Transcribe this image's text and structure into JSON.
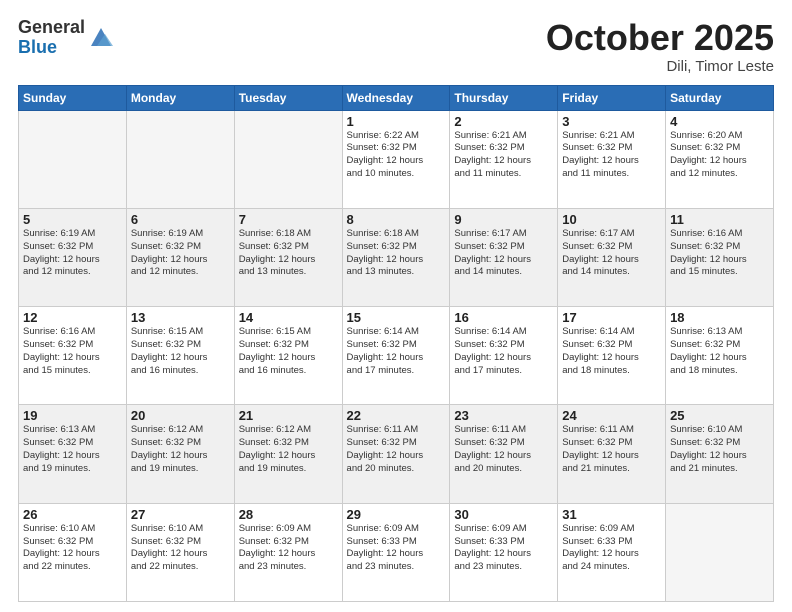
{
  "header": {
    "logo_general": "General",
    "logo_blue": "Blue",
    "month_year": "October 2025",
    "location": "Dili, Timor Leste"
  },
  "days_of_week": [
    "Sunday",
    "Monday",
    "Tuesday",
    "Wednesday",
    "Thursday",
    "Friday",
    "Saturday"
  ],
  "weeks": [
    [
      {
        "day": "",
        "info": ""
      },
      {
        "day": "",
        "info": ""
      },
      {
        "day": "",
        "info": ""
      },
      {
        "day": "1",
        "info": "Sunrise: 6:22 AM\nSunset: 6:32 PM\nDaylight: 12 hours\nand 10 minutes."
      },
      {
        "day": "2",
        "info": "Sunrise: 6:21 AM\nSunset: 6:32 PM\nDaylight: 12 hours\nand 11 minutes."
      },
      {
        "day": "3",
        "info": "Sunrise: 6:21 AM\nSunset: 6:32 PM\nDaylight: 12 hours\nand 11 minutes."
      },
      {
        "day": "4",
        "info": "Sunrise: 6:20 AM\nSunset: 6:32 PM\nDaylight: 12 hours\nand 12 minutes."
      }
    ],
    [
      {
        "day": "5",
        "info": "Sunrise: 6:19 AM\nSunset: 6:32 PM\nDaylight: 12 hours\nand 12 minutes."
      },
      {
        "day": "6",
        "info": "Sunrise: 6:19 AM\nSunset: 6:32 PM\nDaylight: 12 hours\nand 12 minutes."
      },
      {
        "day": "7",
        "info": "Sunrise: 6:18 AM\nSunset: 6:32 PM\nDaylight: 12 hours\nand 13 minutes."
      },
      {
        "day": "8",
        "info": "Sunrise: 6:18 AM\nSunset: 6:32 PM\nDaylight: 12 hours\nand 13 minutes."
      },
      {
        "day": "9",
        "info": "Sunrise: 6:17 AM\nSunset: 6:32 PM\nDaylight: 12 hours\nand 14 minutes."
      },
      {
        "day": "10",
        "info": "Sunrise: 6:17 AM\nSunset: 6:32 PM\nDaylight: 12 hours\nand 14 minutes."
      },
      {
        "day": "11",
        "info": "Sunrise: 6:16 AM\nSunset: 6:32 PM\nDaylight: 12 hours\nand 15 minutes."
      }
    ],
    [
      {
        "day": "12",
        "info": "Sunrise: 6:16 AM\nSunset: 6:32 PM\nDaylight: 12 hours\nand 15 minutes."
      },
      {
        "day": "13",
        "info": "Sunrise: 6:15 AM\nSunset: 6:32 PM\nDaylight: 12 hours\nand 16 minutes."
      },
      {
        "day": "14",
        "info": "Sunrise: 6:15 AM\nSunset: 6:32 PM\nDaylight: 12 hours\nand 16 minutes."
      },
      {
        "day": "15",
        "info": "Sunrise: 6:14 AM\nSunset: 6:32 PM\nDaylight: 12 hours\nand 17 minutes."
      },
      {
        "day": "16",
        "info": "Sunrise: 6:14 AM\nSunset: 6:32 PM\nDaylight: 12 hours\nand 17 minutes."
      },
      {
        "day": "17",
        "info": "Sunrise: 6:14 AM\nSunset: 6:32 PM\nDaylight: 12 hours\nand 18 minutes."
      },
      {
        "day": "18",
        "info": "Sunrise: 6:13 AM\nSunset: 6:32 PM\nDaylight: 12 hours\nand 18 minutes."
      }
    ],
    [
      {
        "day": "19",
        "info": "Sunrise: 6:13 AM\nSunset: 6:32 PM\nDaylight: 12 hours\nand 19 minutes."
      },
      {
        "day": "20",
        "info": "Sunrise: 6:12 AM\nSunset: 6:32 PM\nDaylight: 12 hours\nand 19 minutes."
      },
      {
        "day": "21",
        "info": "Sunrise: 6:12 AM\nSunset: 6:32 PM\nDaylight: 12 hours\nand 19 minutes."
      },
      {
        "day": "22",
        "info": "Sunrise: 6:11 AM\nSunset: 6:32 PM\nDaylight: 12 hours\nand 20 minutes."
      },
      {
        "day": "23",
        "info": "Sunrise: 6:11 AM\nSunset: 6:32 PM\nDaylight: 12 hours\nand 20 minutes."
      },
      {
        "day": "24",
        "info": "Sunrise: 6:11 AM\nSunset: 6:32 PM\nDaylight: 12 hours\nand 21 minutes."
      },
      {
        "day": "25",
        "info": "Sunrise: 6:10 AM\nSunset: 6:32 PM\nDaylight: 12 hours\nand 21 minutes."
      }
    ],
    [
      {
        "day": "26",
        "info": "Sunrise: 6:10 AM\nSunset: 6:32 PM\nDaylight: 12 hours\nand 22 minutes."
      },
      {
        "day": "27",
        "info": "Sunrise: 6:10 AM\nSunset: 6:32 PM\nDaylight: 12 hours\nand 22 minutes."
      },
      {
        "day": "28",
        "info": "Sunrise: 6:09 AM\nSunset: 6:32 PM\nDaylight: 12 hours\nand 23 minutes."
      },
      {
        "day": "29",
        "info": "Sunrise: 6:09 AM\nSunset: 6:33 PM\nDaylight: 12 hours\nand 23 minutes."
      },
      {
        "day": "30",
        "info": "Sunrise: 6:09 AM\nSunset: 6:33 PM\nDaylight: 12 hours\nand 23 minutes."
      },
      {
        "day": "31",
        "info": "Sunrise: 6:09 AM\nSunset: 6:33 PM\nDaylight: 12 hours\nand 24 minutes."
      },
      {
        "day": "",
        "info": ""
      }
    ]
  ]
}
